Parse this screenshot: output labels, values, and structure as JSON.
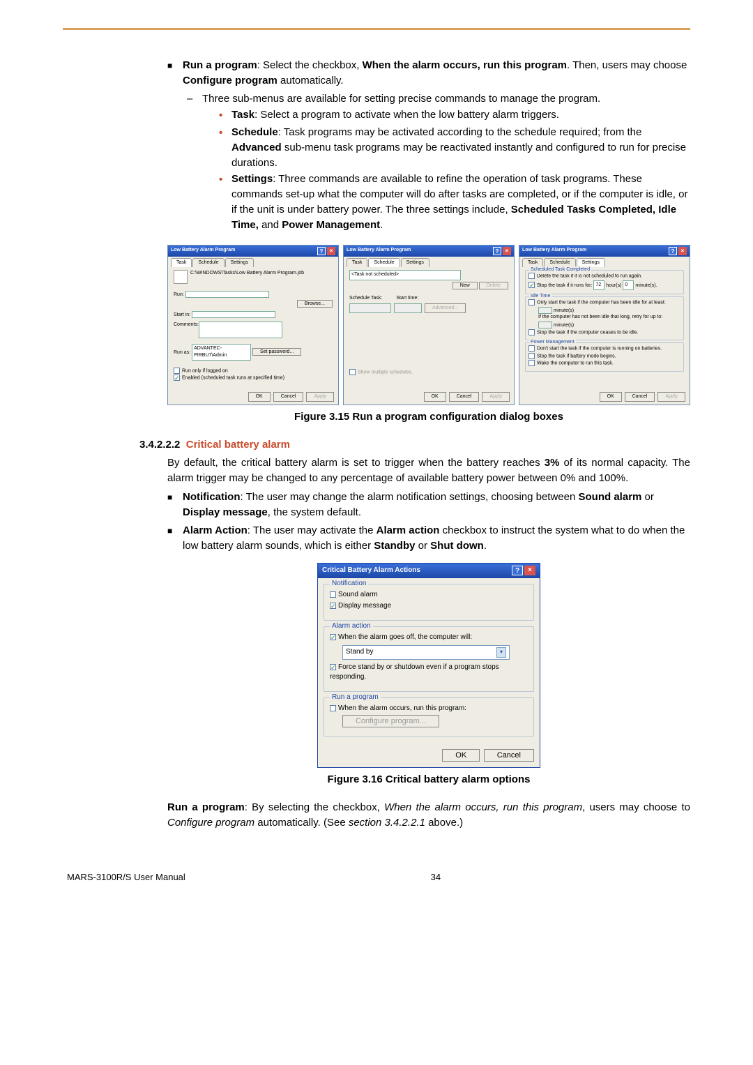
{
  "top": {
    "run_title": "Run a program",
    "run_body1": ": Select the checkbox, ",
    "run_bold1": "When the alarm occurs, run this program",
    "run_body2": ". Then, users may choose ",
    "run_bold2": "Configure program",
    "run_body3": " automatically.",
    "dash1": "Three sub-menus are available for setting precise commands to manage the program.",
    "task_b": "Task",
    "task_t": ": Select a program to activate when the low battery alarm triggers.",
    "sched_b": "Schedule",
    "sched_t1": ": Task programs may be activated according to the schedule required; from the ",
    "sched_bold": "Advanced",
    "sched_t2": " sub-menu task programs may be reactivated instantly and configured to run for precise durations.",
    "set_b": "Settings",
    "set_t1": ": Three commands are available to refine the operation of task programs. These commands set-up what the computer will do after tasks are completed, or if the computer is idle, or if the unit is under battery power. The three settings include, ",
    "set_bold": "Scheduled Tasks Completed, Idle Time,",
    "set_t2": " and ",
    "set_bold2": "Power Management",
    "set_t3": "."
  },
  "fig1": {
    "dlg_title": "Low Battery Alarm Program",
    "tabs": {
      "task": "Task",
      "schedule": "Schedule",
      "settings": "Settings"
    },
    "path": "C:\\WINDOWS\\Tasks\\Low Battery Alarm Program.job",
    "run": "Run:",
    "browse": "Browse...",
    "startin": "Start in:",
    "comments": "Comments:",
    "runas": "Run as:",
    "runas_val": "ADVANTEC-PIRBU7\\Admin",
    "setpw": "Set password...",
    "runonly": "Run only if logged on",
    "enabled": "Enabled (scheduled task runs at specified time)",
    "ok": "OK",
    "cancel": "Cancel",
    "apply": "Apply",
    "task_not": "<Task not scheduled>",
    "new": "New",
    "delete": "Delete",
    "sched_task": "Schedule Task:",
    "start_time": "Start time:",
    "advanced": "Advanced...",
    "show_mult": "Show multiple schedules.",
    "g_stc": "Scheduled Task Completed",
    "stc1": "Delete the task if it is not scheduled to run again.",
    "stc2a": "Stop the task if it runs for:",
    "stc_h": "72",
    "stc_hl": "hour(s)",
    "stc_m": "0",
    "stc_ml": "minute(s).",
    "g_idle": "Idle Time",
    "idle1": "Only start the task if the computer has been idle for at least:",
    "idle_mins": "minute(s)",
    "idle2": "If the computer has not been idle that long, retry for up to:",
    "idle3": "Stop the task if the computer ceases to be idle.",
    "g_pm": "Power Management",
    "pm1": "Don't start the task if the computer is running on batteries.",
    "pm2": "Stop the task if battery mode begins.",
    "pm3": "Wake the computer to run this task.",
    "caption": "Figure 3.15 Run a program configuration dialog boxes"
  },
  "sec": {
    "num": "3.4.2.2.2",
    "title": "Critical battery alarm",
    "p1a": "By default, the critical battery alarm is set to trigger when the battery reaches ",
    "p1b": "3%",
    "p1c": " of its normal capacity. The alarm trigger may be changed to any percentage of available battery power between 0% and 100%.",
    "notif_b": "Notification",
    "notif_t1": ": The user may change the alarm notification settings, choosing between ",
    "notif_bold1": "Sound alarm",
    "notif_t2": " or ",
    "notif_bold2": "Display message",
    "notif_t3": ", the system default.",
    "aa_b": "Alarm Action",
    "aa_t1": ": The user may activate the ",
    "aa_bold1": "Alarm action",
    "aa_t2": " checkbox to instruct the system what to do when the low battery alarm sounds, which is either ",
    "aa_bold2": "Standby",
    "aa_t3": " or ",
    "aa_bold3": "Shut down",
    "aa_t4": "."
  },
  "dlg2": {
    "title": "Critical Battery Alarm Actions",
    "g_notif": "Notification",
    "sound": "Sound alarm",
    "disp": "Display message",
    "g_action": "Alarm action",
    "when": "When the alarm goes off, the computer will:",
    "standby": "Stand by",
    "force": "Force stand by or shutdown even if a program stops responding.",
    "g_run": "Run a program",
    "when2": "When the alarm occurs, run this program:",
    "config": "Configure program...",
    "ok": "OK",
    "cancel": "Cancel",
    "caption": "Figure 3.16 Critical battery alarm options"
  },
  "bottom": {
    "b1": "Run a program",
    "t1": ": By selecting the checkbox, ",
    "i1": "When the alarm occurs, run this program",
    "t2": ", users may choose to ",
    "i2": "Configure program",
    "t3": " automatically. (See ",
    "i3": "section 3.4.2.2.1",
    "t4": " above.)"
  },
  "footer": {
    "left": "MARS-3100R/S User Manual",
    "page": "34"
  }
}
